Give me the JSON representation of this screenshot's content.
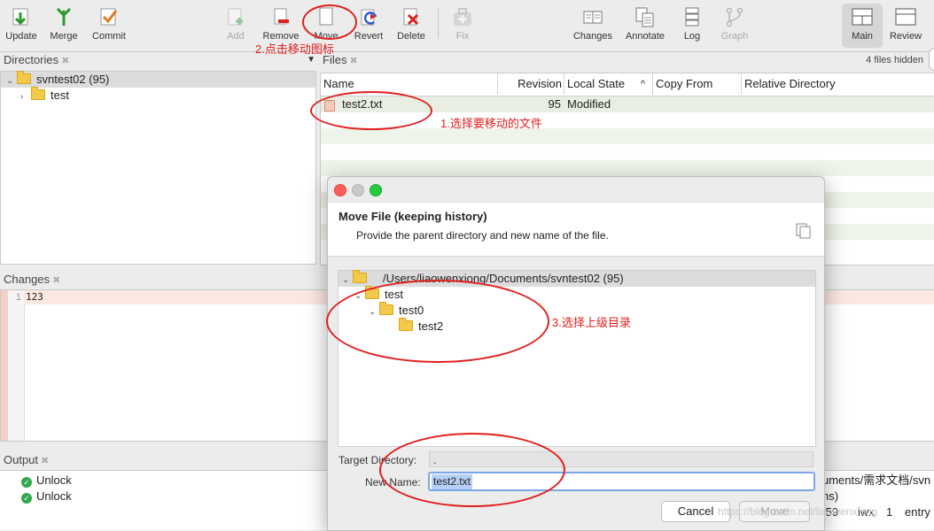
{
  "toolbar": {
    "update": "Update",
    "merge": "Merge",
    "commit": "Commit",
    "add": "Add",
    "remove": "Remove",
    "move": "Move",
    "revert": "Revert",
    "delete": "Delete",
    "fix": "Fix",
    "changes": "Changes",
    "annotate": "Annotate",
    "log": "Log",
    "graph": "Graph",
    "main": "Main",
    "review": "Review"
  },
  "directories": {
    "header": "Directories",
    "root": "svntest02 (95)",
    "child": "test"
  },
  "files": {
    "header": "Files",
    "hidden_count": "4 files hidden",
    "columns": [
      "Name",
      "Revision",
      "Local State",
      "Copy From",
      "Relative Directory"
    ],
    "sort_indicator": "^",
    "rows": [
      {
        "name": "test2.txt",
        "revision": "95",
        "state": "Modified"
      }
    ]
  },
  "changes": {
    "header": "Changes",
    "line_no": "1",
    "content": "123"
  },
  "output": {
    "header": "Output",
    "rows": [
      "Unlock",
      "Unlock"
    ],
    "right_line1": "uments/需求文档/svn",
    "right_line2": "ns)",
    "right_line3": ".59",
    "right_line3b": "iwx",
    "right_line3c": "1",
    "right_line3d": "entry"
  },
  "dialog": {
    "title": "Move File (keeping history)",
    "subtitle": "Provide the parent directory and new name of the file.",
    "tree_root": "/Users/liaowenxiong/Documents/svntest02 (95)",
    "tree_items": [
      "test",
      "test0",
      "test2"
    ],
    "target_label": "Target Directory:",
    "target_value": ".",
    "name_label": "New Name:",
    "name_value": "test2.txt",
    "cancel": "Cancel",
    "move": "Move"
  },
  "annotations": {
    "step1": "1.选择要移动的文件",
    "step2": "2.点击移动图标",
    "step3": "3.选择上级目录"
  },
  "watermark": "https://blog.csdn.net/liaowenxiong",
  "colors": {
    "annotation": "#e0201e",
    "selection": "#b6d0f5",
    "stripe": "#f0f6ec"
  }
}
